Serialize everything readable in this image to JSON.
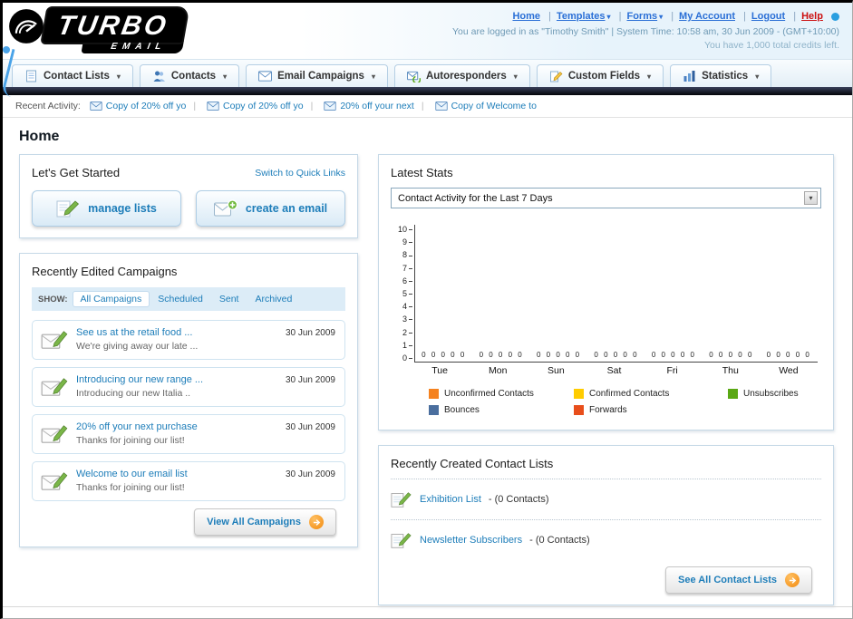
{
  "header": {
    "logo": {
      "title": "TURBO",
      "subtitle": "EMAIL"
    },
    "links": [
      {
        "label": "Home"
      },
      {
        "label": "Templates"
      },
      {
        "label": "Forms"
      },
      {
        "label": "My Account"
      },
      {
        "label": "Logout"
      },
      {
        "label": "Help"
      }
    ],
    "login_info": "You are logged in as \"Timothy Smith\" | System Time: 10:58 am, 30 Jun 2009 - (GMT+10:00)",
    "credits_info": "You have 1,000 total credits left."
  },
  "main_nav": {
    "items": [
      {
        "label": "Contact Lists"
      },
      {
        "label": "Contacts"
      },
      {
        "label": "Email Campaigns"
      },
      {
        "label": "Autoresponders"
      },
      {
        "label": "Custom Fields"
      },
      {
        "label": "Statistics"
      }
    ]
  },
  "recent_activity": {
    "label": "Recent Activity:",
    "items": [
      {
        "label": "Copy of 20% off yo"
      },
      {
        "label": "Copy of 20% off yo"
      },
      {
        "label": "20% off your next"
      },
      {
        "label": "Copy of Welcome to"
      }
    ]
  },
  "page": {
    "title": "Home"
  },
  "get_started": {
    "title": "Let's Get Started",
    "switch_link": "Switch to Quick Links",
    "manage_lists_label": "manage lists",
    "create_email_label": "create an email"
  },
  "campaigns": {
    "title": "Recently Edited Campaigns",
    "show_label": "SHOW:",
    "tabs": [
      {
        "label": "All Campaigns"
      },
      {
        "label": "Scheduled"
      },
      {
        "label": "Sent"
      },
      {
        "label": "Archived"
      }
    ],
    "active_tab": "All Campaigns",
    "items": [
      {
        "title": "See us at the retail food ...",
        "subtitle": "We're giving away our late ...",
        "date": "30 Jun 2009"
      },
      {
        "title": "Introducing our new range ...",
        "subtitle": "Introducing our new Italia ..",
        "date": "30 Jun 2009"
      },
      {
        "title": "20% off your next purchase",
        "subtitle": "Thanks for joining our list!",
        "date": "30 Jun 2009"
      },
      {
        "title": "Welcome to our email list",
        "subtitle": "Thanks for joining our list!",
        "date": "30 Jun 2009"
      }
    ],
    "view_all_label": "View All Campaigns"
  },
  "stats": {
    "title": "Latest Stats",
    "dropdown_value": "Contact Activity for the Last 7 Days",
    "legend": [
      {
        "label": "Unconfirmed Contacts",
        "color": "#f5821f"
      },
      {
        "label": "Confirmed Contacts",
        "color": "#ffcc00"
      },
      {
        "label": "Unsubscribes",
        "color": "#5aa814"
      },
      {
        "label": "Bounces",
        "color": "#4a6e9e"
      },
      {
        "label": "Forwards",
        "color": "#e84e1b"
      }
    ]
  },
  "chart_data": {
    "type": "bar",
    "title": "Contact Activity for the Last 7 Days",
    "categories": [
      "Tue",
      "Mon",
      "Sun",
      "Sat",
      "Fri",
      "Thu",
      "Wed"
    ],
    "series": [
      {
        "name": "Unconfirmed Contacts",
        "values": [
          0,
          0,
          0,
          0,
          0,
          0,
          0
        ]
      },
      {
        "name": "Confirmed Contacts",
        "values": [
          0,
          0,
          0,
          0,
          0,
          0,
          0
        ]
      },
      {
        "name": "Unsubscribes",
        "values": [
          0,
          0,
          0,
          0,
          0,
          0,
          0
        ]
      },
      {
        "name": "Bounces",
        "values": [
          0,
          0,
          0,
          0,
          0,
          0,
          0
        ]
      },
      {
        "name": "Forwards",
        "values": [
          0,
          0,
          0,
          0,
          0,
          0,
          0
        ]
      }
    ],
    "xlabel": "",
    "ylabel": "",
    "ylim": [
      0,
      10
    ],
    "yticks": [
      0,
      1,
      2,
      3,
      4,
      5,
      6,
      7,
      8,
      9,
      10
    ],
    "grid": false,
    "legend_position": "bottom"
  },
  "contact_lists": {
    "title": "Recently Created Contact Lists",
    "items": [
      {
        "name": "Exhibition List",
        "count": "- (0 Contacts)"
      },
      {
        "name": "Newsletter Subscribers",
        "count": "- (0 Contacts)"
      }
    ],
    "see_all_label": "See All Contact Lists"
  }
}
